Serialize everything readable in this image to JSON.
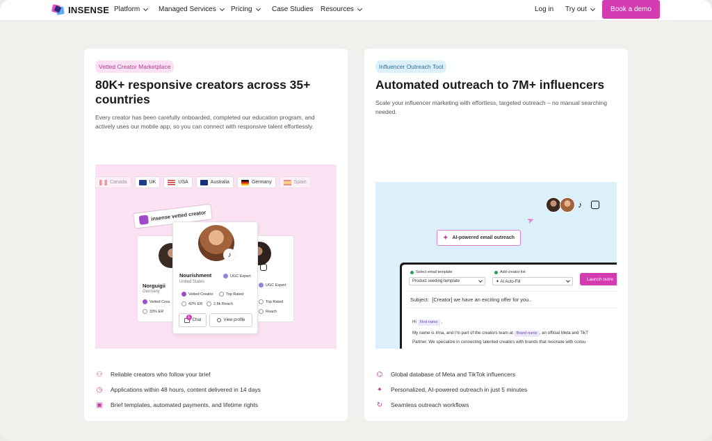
{
  "nav": {
    "brand": "INSENSE",
    "links": [
      "Platform",
      "Managed Services",
      "Pricing",
      "Case Studies",
      "Resources"
    ],
    "login": "Log in",
    "try_out": "Try out",
    "cta": "Book a demo"
  },
  "left_card": {
    "pill": "Vetted Creator Marketplace",
    "title": "80K+ responsive creators across 35+ countries",
    "description": "Every creator has been carefully onboarded, completed our education program, and actively uses our mobile app; so you can connect with responsive talent effortlessly.",
    "countries": [
      "Canada",
      "UK",
      "USA",
      "Australia",
      "Germany",
      "Spain"
    ],
    "vetted_tag": "insense vetted creator",
    "creator_main": {
      "name": "Nourishment",
      "country": "United States",
      "badge": "UGC Expert",
      "vetted": "Vetted Creator",
      "rated": "Top Rated",
      "er": "42% ER",
      "reach": "2,8k Reach",
      "chat": "Chat",
      "chat_count": "1",
      "view": "View profile"
    },
    "creator_left": {
      "name": "Norguigii",
      "country": "Germany",
      "vetted": "Vetted Crea",
      "er": "33% ER"
    },
    "creator_right": {
      "badge": "UGC Expert",
      "rated": "Top Rated",
      "reach": "Reach"
    },
    "features": [
      "Reliable creators who follow your brief",
      "Applications within 48 hours, content delivered in 14 days",
      "Brief templates, automated payments, and lifetime rights"
    ]
  },
  "right_card": {
    "pill": "Influencer Outreach Tool",
    "title": "Automated outreach to 7M+ influencers",
    "description": "Scale your influencer marketing with effortless, targeted outreach – no manual searching needed.",
    "ai_tag": "AI-powered email outreach",
    "email_ui": {
      "template_label": "Select email template",
      "template_value": "Product seeding template",
      "list_label": "Add creator list",
      "list_value": "AI Auto-Fill",
      "launch": "Launch outre",
      "subject_label": "Subject:",
      "subject_value": "[Creator] we have an exciting offer for you..",
      "greeting": "Hi",
      "first_name_tag": "First name",
      "line1_a": "My name is Irina, and I'm part of the creators team at",
      "brand_tag": "Brand name",
      "line1_b": ", an official Meta and TikT",
      "line2": "Partner. We specialize in connecting talented creators with brands that resonate with consu"
    },
    "features": [
      "Global database of Meta and TikTok influencers",
      "Personalized, AI-powered outreach in just 5 minutes",
      "Seamless outreach workflows"
    ]
  },
  "colors": {
    "brand": "#d33bb1",
    "pink_bg": "#fbe2f3",
    "blue_bg": "#dcf0fb"
  }
}
